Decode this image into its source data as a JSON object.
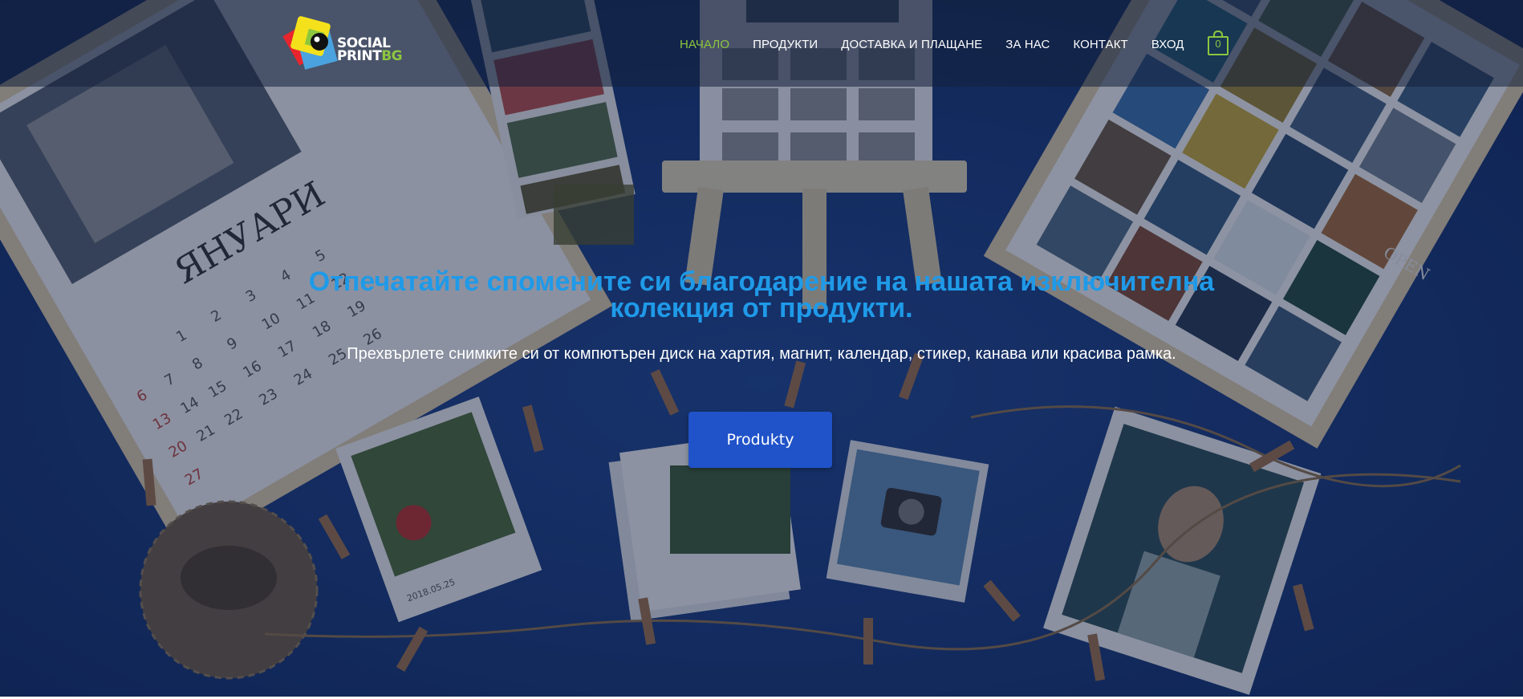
{
  "logo": {
    "line1": "SOCIAL",
    "line2": "PRINT",
    "line2_suffix": "BG"
  },
  "nav": {
    "items": [
      {
        "label": "НАЧАЛО",
        "active": true
      },
      {
        "label": "ПРОДУКТИ",
        "active": false
      },
      {
        "label": "ДОСТАВКА И ПЛАЩАНЕ",
        "active": false
      },
      {
        "label": "ЗА НАС",
        "active": false
      },
      {
        "label": "КОНТАКТ",
        "active": false
      },
      {
        "label": "ВХОД",
        "active": false
      }
    ]
  },
  "cart": {
    "count": "0",
    "icon": "shopping-bag-icon"
  },
  "hero": {
    "title_line1": "Отпечатайте спомените си благодарение на нашата изключителна",
    "title_line2": "колекция от продукти.",
    "subtitle": "Прехвърлете снимките си от компютърен диск на хартия, магнит, календар, стикер, канава или красива рамка.",
    "cta_label": "Produkty",
    "calendar_month": "ЯНУАРИ",
    "sign_text": "OPEN",
    "photo_date": "2018.05.25"
  },
  "colors": {
    "accent_green": "#8cc63f",
    "title_blue": "#1f9ae8",
    "button_blue": "#2053c9",
    "background_navy": "#1a3a7a"
  }
}
